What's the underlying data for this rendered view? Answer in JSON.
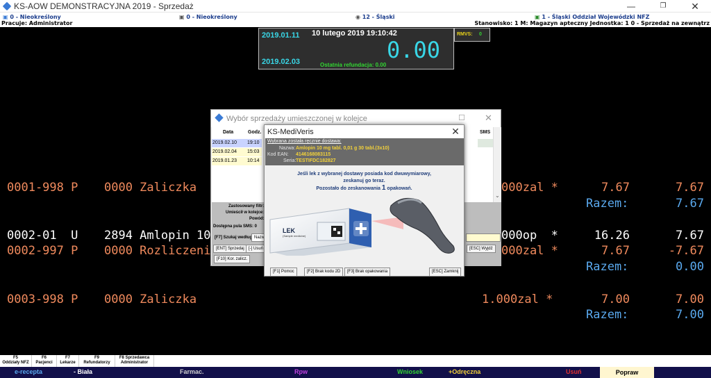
{
  "window": {
    "title": "KS-AOW DEMONSTRACYJNA 2019 - Sprzedaż"
  },
  "info": {
    "item1": "0 - Nieokreślony",
    "item2": "0 - Nieokreślony",
    "item3": "12 - Śląski",
    "item4": "1 - Śląski Oddział Wojewódzki NFZ",
    "pracuje": "Pracuje: Administrator",
    "stanowisko": "Stanowisko: 1   M: Magazyn apteczny   Jednostka: 1   0 - Sprzedaż na zewnątrz"
  },
  "register": {
    "date_top": "2019.01.11",
    "datetime": "10 lutego 2019  19:10:42",
    "date_bottom": "2019.02.03",
    "amount": "0.00",
    "refund": "Ostatnia refundacja: 0.00",
    "rmvs_label": "RMVS:",
    "rmvs_value": "0"
  },
  "rows": [
    {
      "code": "0001-998 P",
      "desc": "0000 Zaliczka",
      "qty": "000zal *",
      "price": "7.67",
      "total": "7.67",
      "color": "orange"
    },
    {
      "razem": "Razem:",
      "total": "7.67"
    },
    {
      "code": "0002-01  U",
      "desc": "2894 Amlopin 10",
      "qty": "000op  *",
      "price": "16.26",
      "total": "7.67",
      "color": "white"
    },
    {
      "code": "0002-997 P",
      "desc": "0000 Rozliczeni",
      "qty": "000zal *",
      "price": "7.67",
      "total": "-7.67",
      "color": "orange"
    },
    {
      "razem": "Razem:",
      "total": "0.00"
    },
    {
      "code": "0003-998 P",
      "desc": "0000 Zaliczka",
      "qty": "1.000zal *",
      "price": "7.00",
      "total": "7.00",
      "color": "orange"
    },
    {
      "razem": "Razem:",
      "total": "7.00"
    }
  ],
  "back_dialog": {
    "title": "Wybór sprzedaży umieszczonej w kolejce",
    "col_data": "Data",
    "col_godz": "Godz.",
    "col_sms": "SMS",
    "rows": [
      {
        "date": "2019.02.10",
        "time": "19:10"
      },
      {
        "date": "2019.02.04",
        "time": "15:03"
      },
      {
        "date": "2019.01.23",
        "time": "10:14"
      }
    ],
    "filter_label": "Zastosowany filtr:",
    "place_label": "Umieścił w kolejce:",
    "reason_label": "Powód:",
    "sms_pool": "Dostępna pula SMS: 0",
    "search_label": "[F7] Szukaj według:",
    "search_value": "Nazwis",
    "btn_sell": "[ENT] Sprzedaj",
    "btn_remove": "[-] Usuń",
    "btn_exit": "[ESC] Wyjdź",
    "btn_kor": "[F10] Kor. zalicz."
  },
  "front_dialog": {
    "title": "KS-MediVeris",
    "subtitle": "Wybrana została ręcznie dostawa:",
    "name_label": "Nazwa:",
    "name_value": "Amlopin 10 mg tabl. 0,01 g 30 tabl.(3x10)",
    "ean_label": "Kod EAN:",
    "ean_value": "4146168083115",
    "series_label": "Seria:",
    "series_value": "TESTIFDC182827",
    "msg1": "Jeśli lek z wybranej dostawy posiada kod dwuwymiarowy,",
    "msg2": "zeskanuj go teraz.",
    "msg3": "Pozostało do zeskanowania",
    "msg_count": "1",
    "msg4": "opakowań.",
    "box_label": "LEK",
    "box_sublabel": "(Sample medicine)",
    "btn_help": "[F1] Pomoc",
    "btn_no2d": "[F2] Brak kodu 2D",
    "btn_nopack": "[F3] Brak opakowania",
    "btn_close": "[ESC] Zamknij"
  },
  "fkeys": [
    {
      "key": "F5",
      "label": "Oddziały NFZ"
    },
    {
      "key": "F6",
      "label": "Pacjenci"
    },
    {
      "key": "F7",
      "label": "Lekarze"
    },
    {
      "key": "F9",
      "label": "Refundatorzy"
    },
    {
      "key": "F8 Sprzedawca",
      "label": "Administrator"
    }
  ],
  "actions": {
    "erecepta": "e-recepta",
    "biala": "- Biała",
    "farmac": "Farmac.",
    "rpw": "Rpw",
    "wniosek": "Wniosek",
    "odreczna": "+Odręczna",
    "usun": "Usuń",
    "popraw": "Popraw"
  },
  "colors": {
    "cyan": "#39d6e6",
    "orange": "#f08a5d",
    "blue": "#5aa9ee",
    "green": "#33d633",
    "yellow": "#e8d21a",
    "navy": "#12104a"
  }
}
